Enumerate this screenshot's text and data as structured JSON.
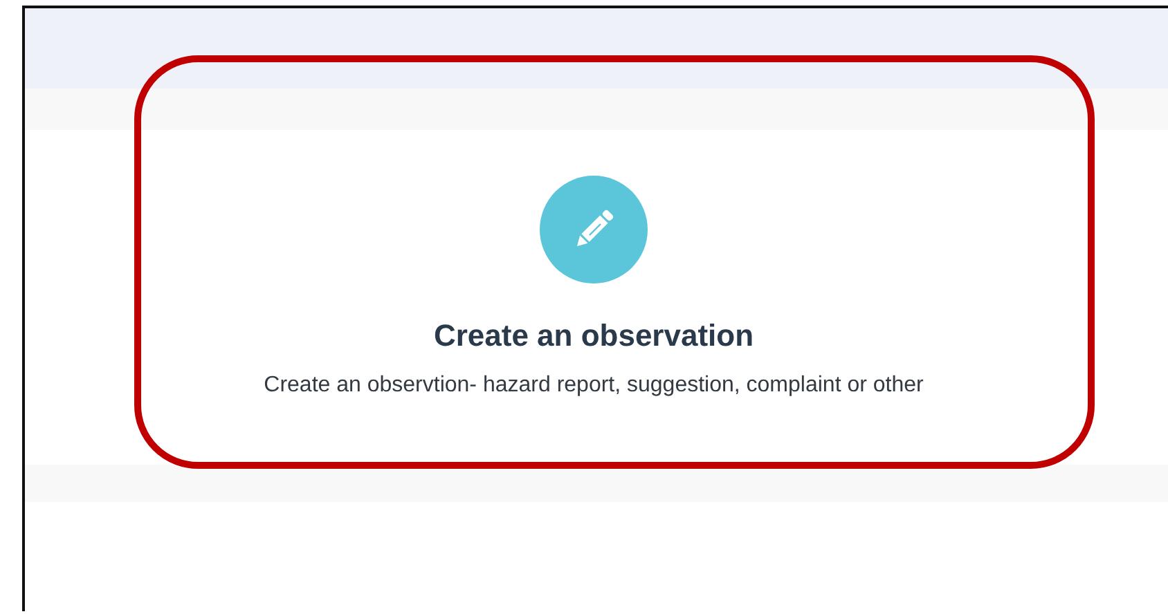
{
  "card": {
    "title": "Create an observation",
    "description": "Create an observtion- hazard report, suggestion, complaint or other"
  }
}
